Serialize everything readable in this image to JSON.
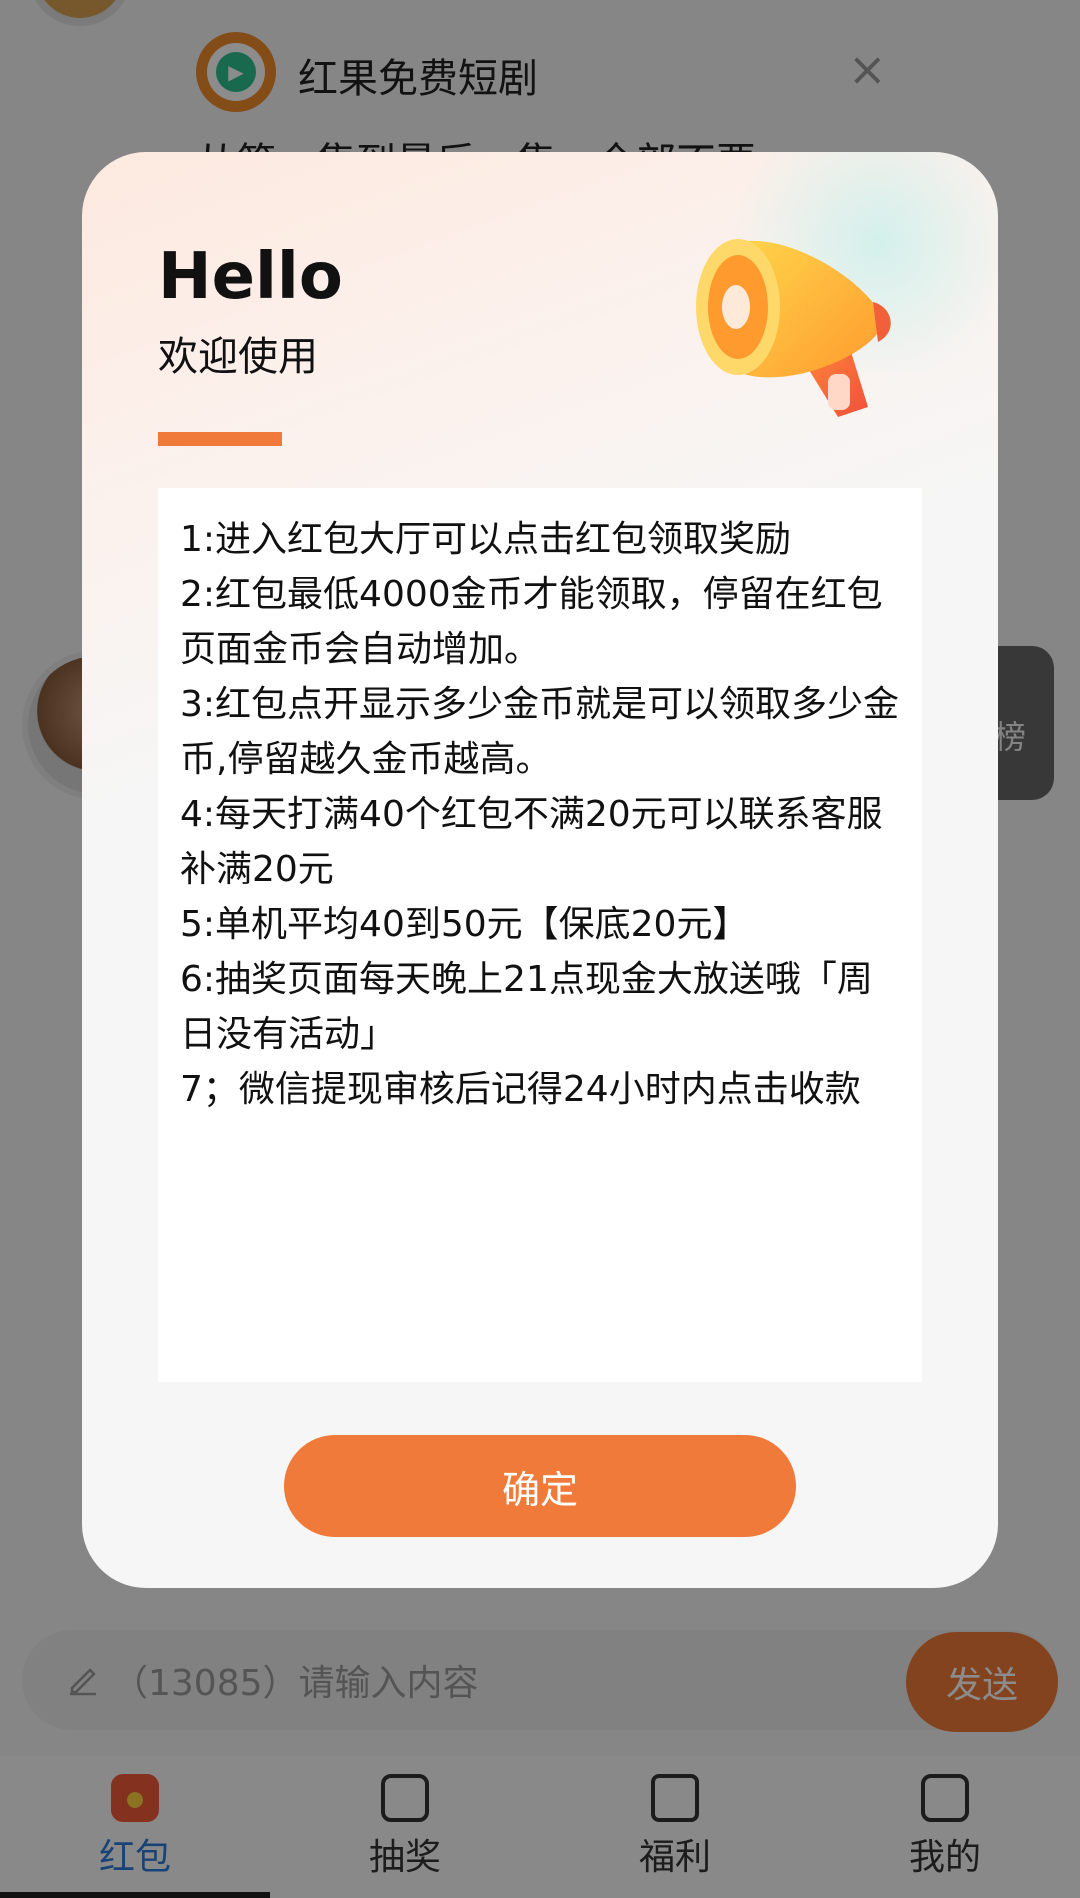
{
  "background": {
    "ad": {
      "title": "红果免费短剧",
      "close_glyph": "×",
      "subtitle": "从第一集到最后一集，全部不要"
    },
    "rank_label": "榜",
    "input": {
      "placeholder": "（13085）请输入内容",
      "send_label": "发送"
    },
    "tabs": [
      {
        "label": "红包",
        "icon": "red-packet-icon",
        "active": true
      },
      {
        "label": "抽奖",
        "icon": "lottery-icon",
        "active": false
      },
      {
        "label": "福利",
        "icon": "tv-icon",
        "active": false
      },
      {
        "label": "我的",
        "icon": "profile-icon",
        "active": false
      }
    ]
  },
  "modal": {
    "greeting": "Hello",
    "welcome": "欢迎使用",
    "rules": [
      "1:进入红包大厅可以点击红包领取奖励",
      "2:红包最低4000金币才能领取，停留在红包页面金币会自动增加。",
      "3:红包点开显示多少金币就是可以领取多少金币,停留越久金币越高。",
      "4:每天打满40个红包不满20元可以联系客服补满20元",
      "5:单机平均40到50元【保底20元】",
      "6:抽奖页面每天晚上21点现金大放送哦「周日没有活动」",
      "7；微信提现审核后记得24小时内点击收款"
    ],
    "confirm_label": "确定",
    "colors": {
      "accent": "#f07a3a",
      "overlay": "rgba(0,0,0,0.45)"
    }
  }
}
